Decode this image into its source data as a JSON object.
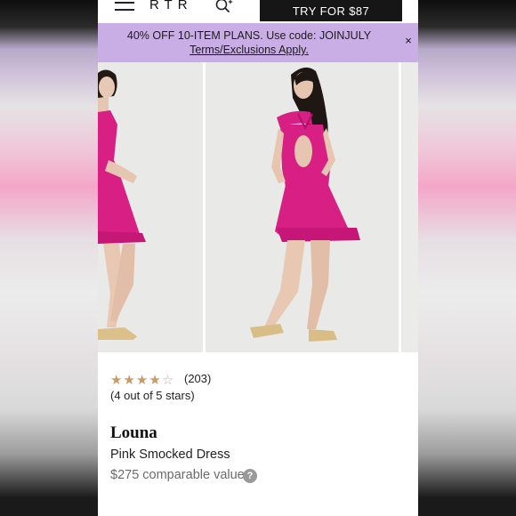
{
  "header": {
    "logo": "RTR",
    "menu_icon": "hamburger-menu-icon",
    "search_icon": "search-sparkle-icon",
    "cta_label": "TRY FOR $87"
  },
  "promo": {
    "text": "40% OFF 10-ITEM PLANS. Use code: JOINJULY",
    "link": "Terms/Exclusions Apply.",
    "close": "×",
    "background": "#c9aee6"
  },
  "product": {
    "rating_stars": 4,
    "rating_max": 5,
    "review_count": "(203)",
    "rating_text": "(4 out of 5 stars)",
    "designer": "Louna",
    "name": "Pink Smocked Dress",
    "price": "$275 comparable value",
    "help_icon": "?",
    "dress_color": "#d81f84",
    "star_color": "#c79a66"
  }
}
